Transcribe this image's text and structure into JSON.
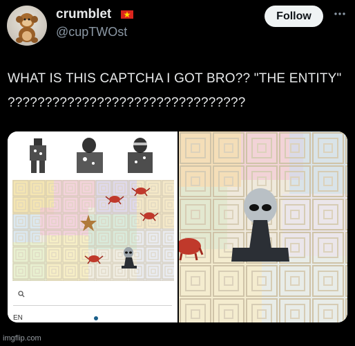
{
  "user": {
    "name": "crumblet",
    "handle": "@cupTWOst",
    "flag_icon": "vietnam-flag-icon"
  },
  "follow_button": "Follow",
  "more_icon": "more-options-icon",
  "tweet": {
    "text": "WHAT IS THIS CAPTCHA I GOT BRO?? \"THE ENTITY\" ????????????????????????????????"
  },
  "captcha": {
    "language": "EN",
    "search_icon": "search-icon"
  },
  "watermark": "imgflip.com",
  "colors": {
    "background": "#000000",
    "text": "#e7e9ea",
    "secondary_text": "#8b98a5",
    "follow_bg": "#eff3f4",
    "flag_red": "#da251d"
  }
}
